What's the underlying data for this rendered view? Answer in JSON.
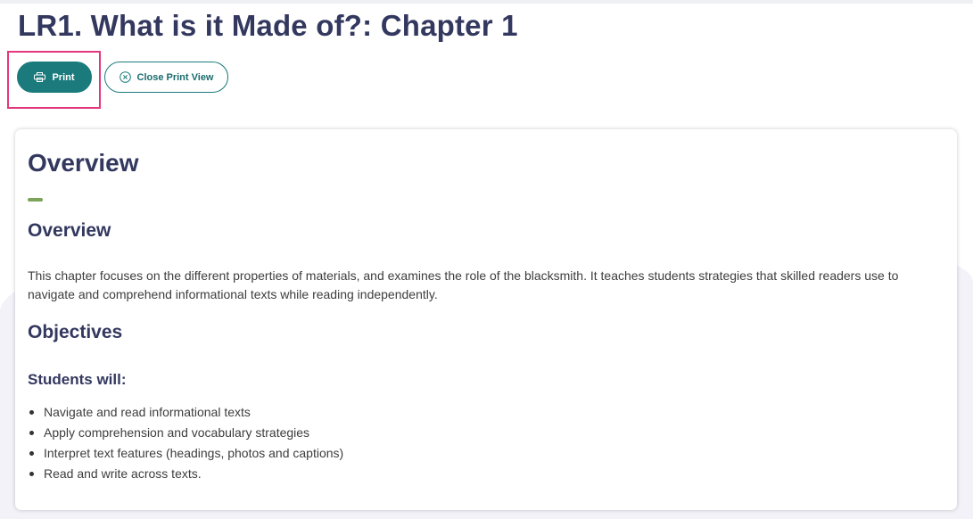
{
  "page": {
    "title": "LR1. What is it Made of?: Chapter 1"
  },
  "toolbar": {
    "print_label": "Print",
    "print_icon": "printer-icon",
    "close_label": "Close Print View",
    "close_icon": "close-circle-icon"
  },
  "colors": {
    "title": "#33385f",
    "primary": "#1b7b7c",
    "accent": "#7ea35a",
    "highlight": "#e3387c"
  },
  "content": {
    "title": "Overview",
    "overview": {
      "heading": "Overview",
      "paragraph": "This chapter focuses on the different properties of materials, and examines the role of the blacksmith. It teaches students strategies that skilled readers use to navigate and comprehend informational texts while reading independently."
    },
    "objectives": {
      "heading": "Objectives",
      "subheading": "Students will:",
      "items": [
        "Navigate and read informational texts",
        "Apply comprehension and vocabulary strategies",
        "Interpret text features (headings, photos and captions)",
        "Read and write across texts."
      ]
    }
  }
}
